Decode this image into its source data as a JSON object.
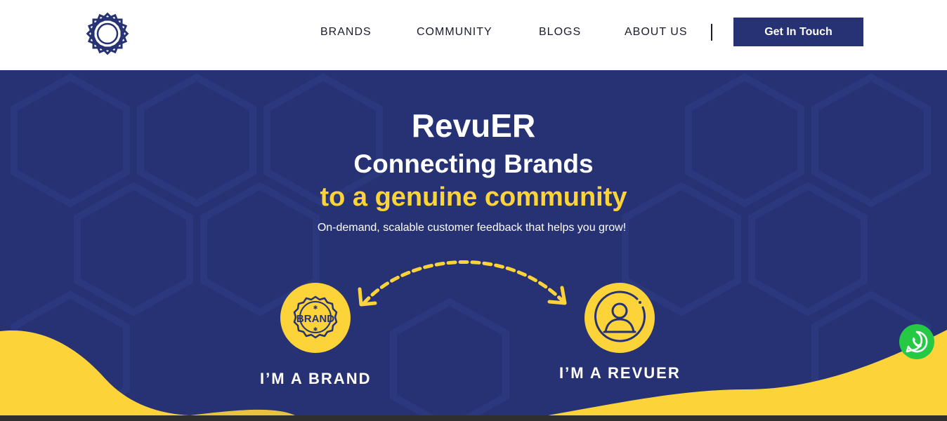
{
  "header": {
    "nav": [
      {
        "label": "BRANDS"
      },
      {
        "label": "COMMUNITY"
      },
      {
        "label": "BLOGS"
      },
      {
        "label": "ABOUT US"
      }
    ],
    "cta_label": "Get In Touch"
  },
  "hero": {
    "title": "RevuER",
    "headline": "Connecting Brands",
    "headline_accent": "to a genuine community",
    "subtitle": "On-demand, scalable customer feedback that helps you grow!",
    "brand_badge_text": "BRAND",
    "brand_label": "I’M A BRAND",
    "revuer_label": "I’M A REVUER"
  },
  "colors": {
    "navy": "#263273",
    "yellow": "#fdd33a",
    "whatsapp_green": "#26c943"
  },
  "icons": [
    "logo-star-icon",
    "brand-badge-icon",
    "user-avatar-icon",
    "whatsapp-icon",
    "dashed-arrows-icon"
  ]
}
